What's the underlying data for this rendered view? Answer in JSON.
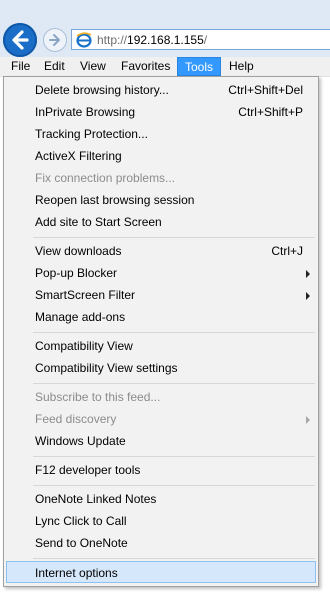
{
  "address": {
    "scheme": "http://",
    "host": "192.168.1.155",
    "path": "/"
  },
  "menubar": {
    "file": "File",
    "edit": "Edit",
    "view": "View",
    "favorites": "Favorites",
    "tools": "Tools",
    "help": "Help"
  },
  "tools_menu": {
    "delete_history": {
      "label": "Delete browsing history...",
      "shortcut": "Ctrl+Shift+Del"
    },
    "inprivate": {
      "label": "InPrivate Browsing",
      "shortcut": "Ctrl+Shift+P"
    },
    "tracking_protection": {
      "label": "Tracking Protection..."
    },
    "activex_filtering": {
      "label": "ActiveX Filtering"
    },
    "fix_connection": {
      "label": "Fix connection problems..."
    },
    "reopen_session": {
      "label": "Reopen last browsing session"
    },
    "add_start_screen": {
      "label": "Add site to Start Screen"
    },
    "view_downloads": {
      "label": "View downloads",
      "shortcut": "Ctrl+J"
    },
    "popup_blocker": {
      "label": "Pop-up Blocker"
    },
    "smartscreen": {
      "label": "SmartScreen Filter"
    },
    "manage_addons": {
      "label": "Manage add-ons"
    },
    "compat_view": {
      "label": "Compatibility View"
    },
    "compat_view_settings": {
      "label": "Compatibility View settings"
    },
    "subscribe_feed": {
      "label": "Subscribe to this feed..."
    },
    "feed_discovery": {
      "label": "Feed discovery"
    },
    "windows_update": {
      "label": "Windows Update"
    },
    "f12_tools": {
      "label": "F12 developer tools"
    },
    "onenote_linked": {
      "label": "OneNote Linked Notes"
    },
    "lync_click": {
      "label": "Lync Click to Call"
    },
    "send_onenote": {
      "label": "Send to OneNote"
    },
    "internet_options": {
      "label": "Internet options"
    }
  },
  "colors": {
    "menu_highlight": "#3399ff",
    "item_hover": "#d5e8fb",
    "disabled_text": "#8c8c8c"
  }
}
